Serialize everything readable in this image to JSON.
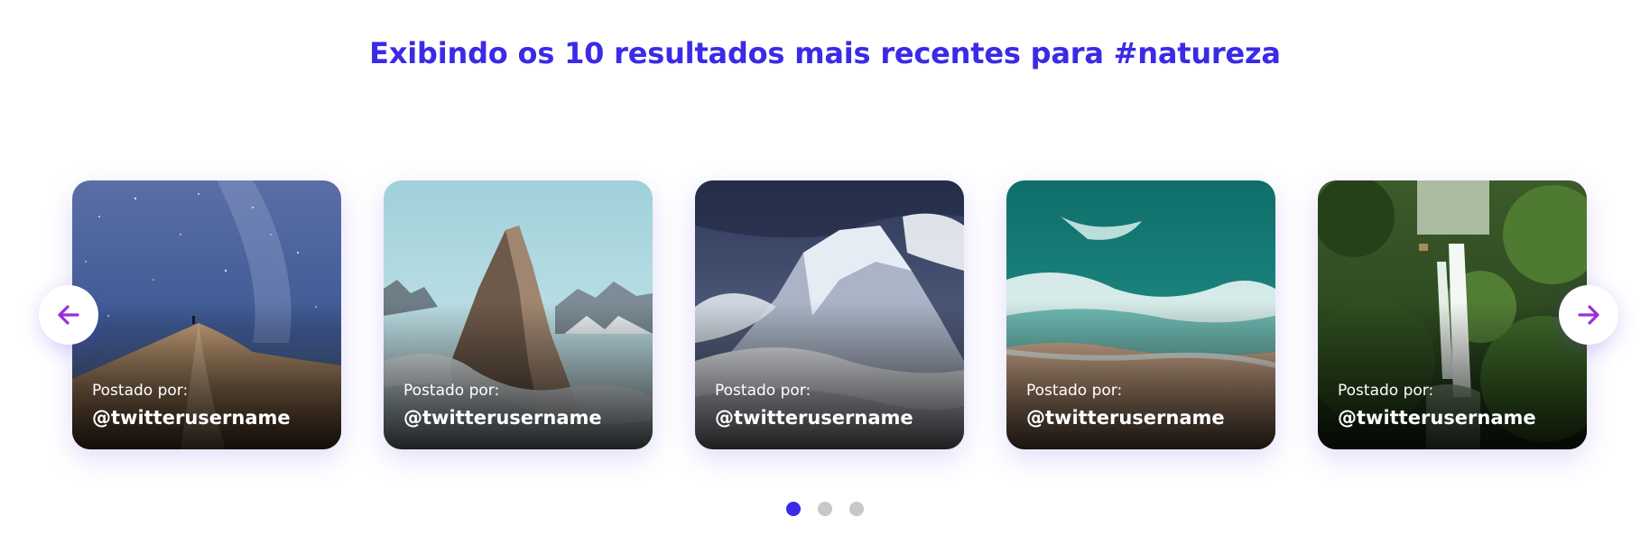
{
  "header": {
    "title": "Exibindo os 10 resultados mais recentes para #natureza"
  },
  "carousel": {
    "cards": [
      {
        "posted_label": "Postado por:",
        "username": "@twitterusername",
        "image": "desert-milky-way-photo"
      },
      {
        "posted_label": "Postado por:",
        "username": "@twitterusername",
        "image": "rocky-peak-above-clouds-photo"
      },
      {
        "posted_label": "Postado por:",
        "username": "@twitterusername",
        "image": "snowy-mountain-clouds-photo"
      },
      {
        "posted_label": "Postado por:",
        "username": "@twitterusername",
        "image": "aerial-ocean-beach-photo"
      },
      {
        "posted_label": "Postado por:",
        "username": "@twitterusername",
        "image": "jungle-waterfall-photo"
      }
    ],
    "prev_icon": "arrow-left-icon",
    "next_icon": "arrow-right-icon"
  },
  "pagination": {
    "pages": 3,
    "active": 1
  },
  "colors": {
    "accent": "#3b2ae6",
    "arrow": "#9b2fd6",
    "dot_inactive": "#c8c8c8"
  }
}
